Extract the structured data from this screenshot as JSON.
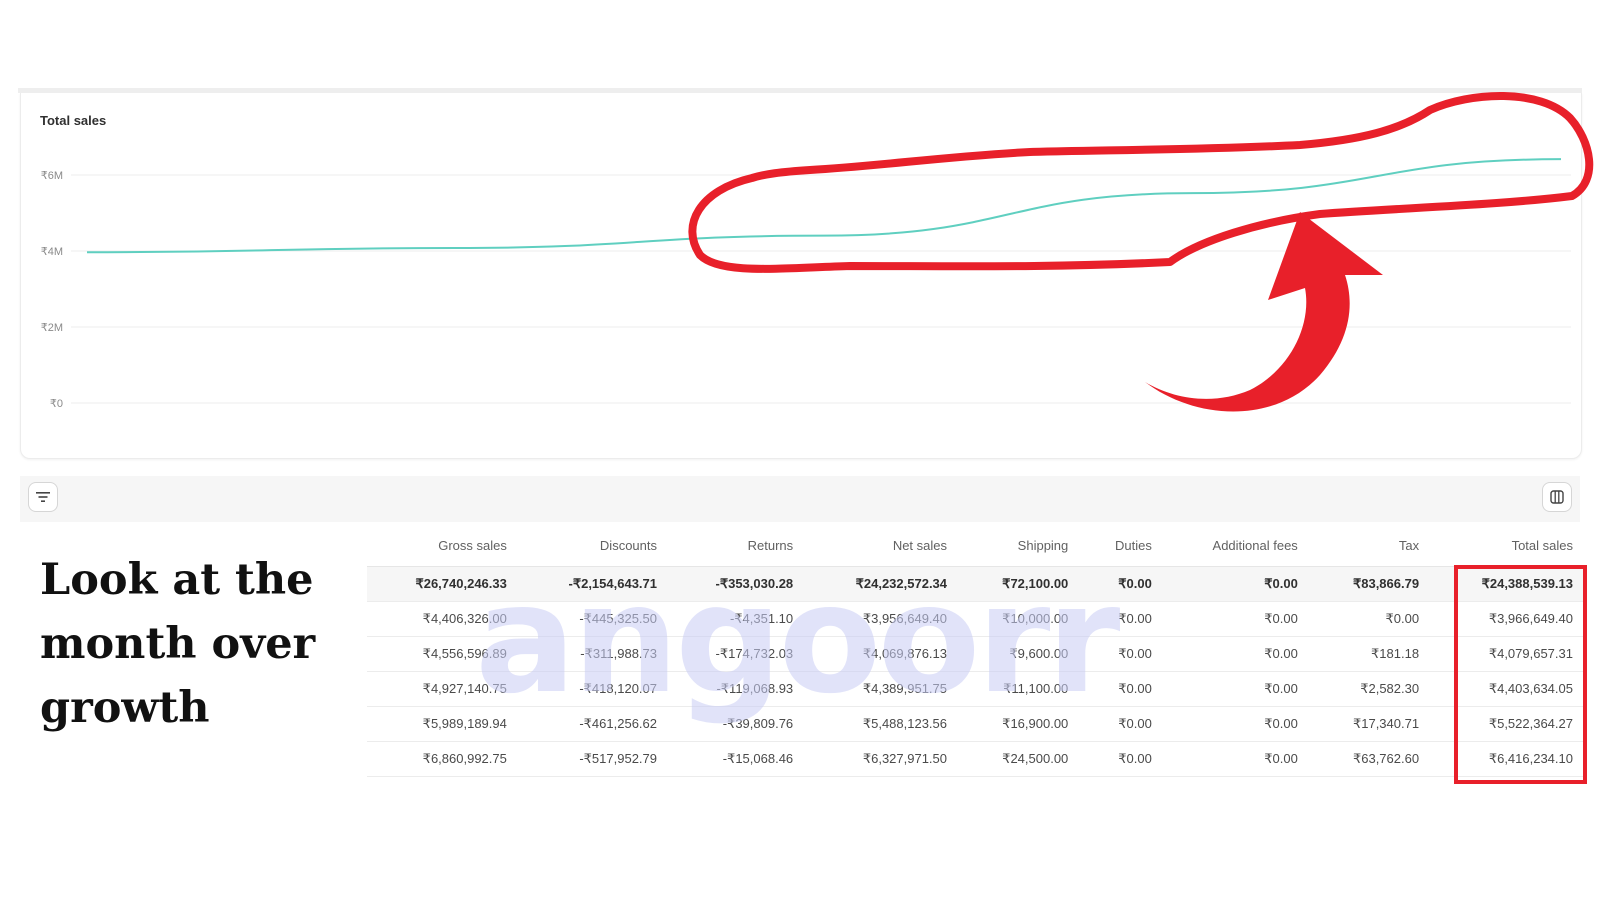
{
  "chart": {
    "title": "Total sales"
  },
  "chart_data": {
    "type": "line",
    "title": "Total sales",
    "ylim": [
      0,
      6500000
    ],
    "y_ticks": [
      "₹0",
      "₹2M",
      "₹4M",
      "₹6M"
    ],
    "y_tick_values": [
      0,
      2000000,
      4000000,
      6000000
    ],
    "series": [
      {
        "x": [
          0,
          1,
          2,
          3,
          4
        ],
        "values": [
          3966649.4,
          4079657.31,
          4403634.05,
          5522364.27,
          6416234.1
        ],
        "color": "#5fcfc0"
      }
    ],
    "grid": true
  },
  "toolbar": {
    "filter_icon": "filter-icon",
    "columns_icon": "columns-icon"
  },
  "table": {
    "headers": [
      "Gross sales",
      "Discounts",
      "Returns",
      "Net sales",
      "Shipping",
      "Duties",
      "Additional fees",
      "Tax",
      "Total sales"
    ],
    "total_row": [
      "₹26,740,246.33",
      "-₹2,154,643.71",
      "-₹353,030.28",
      "₹24,232,572.34",
      "₹72,100.00",
      "₹0.00",
      "₹0.00",
      "₹83,866.79",
      "₹24,388,539.13"
    ],
    "rows": [
      [
        "₹4,406,326.00",
        "-₹445,325.50",
        "-₹4,351.10",
        "₹3,956,649.40",
        "₹10,000.00",
        "₹0.00",
        "₹0.00",
        "₹0.00",
        "₹3,966,649.40"
      ],
      [
        "₹4,556,596.89",
        "-₹311,988.73",
        "-₹174,732.03",
        "₹4,069,876.13",
        "₹9,600.00",
        "₹0.00",
        "₹0.00",
        "₹181.18",
        "₹4,079,657.31"
      ],
      [
        "₹4,927,140.75",
        "-₹418,120.07",
        "-₹119,068.93",
        "₹4,389,951.75",
        "₹11,100.00",
        "₹0.00",
        "₹0.00",
        "₹2,582.30",
        "₹4,403,634.05"
      ],
      [
        "₹5,989,189.94",
        "-₹461,256.62",
        "-₹39,809.76",
        "₹5,488,123.56",
        "₹16,900.00",
        "₹0.00",
        "₹0.00",
        "₹17,340.71",
        "₹5,522,364.27"
      ],
      [
        "₹6,860,992.75",
        "-₹517,952.79",
        "-₹15,068.46",
        "₹6,327,971.50",
        "₹24,500.00",
        "₹0.00",
        "₹0.00",
        "₹63,762.60",
        "₹6,416,234.10"
      ]
    ]
  },
  "watermark": "angoorr",
  "caption": "Look at the month over growth",
  "annotation_color": "#e8202a"
}
